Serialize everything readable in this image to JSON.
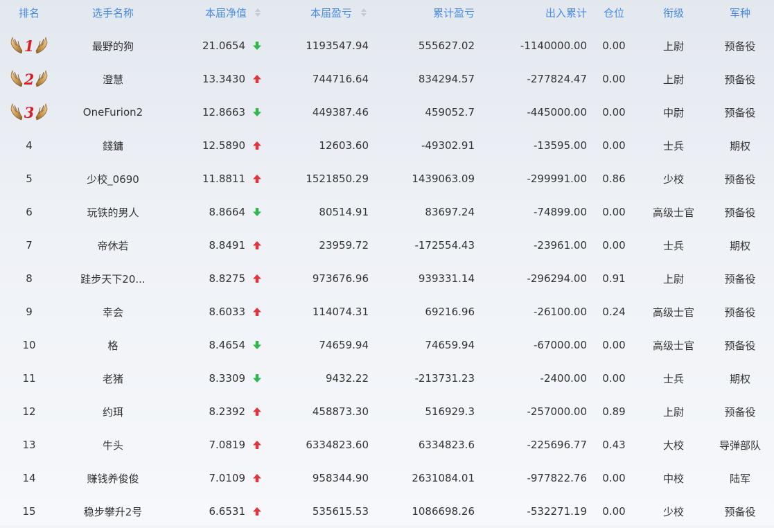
{
  "header": {
    "rank": "排名",
    "name": "选手名称",
    "nav": "本届净值",
    "pnl": "本届盈亏",
    "cumulative": "累计盈亏",
    "flow": "出入累计",
    "position": "仓位",
    "title": "衔级",
    "branch": "军种"
  },
  "colors": {
    "header_text": "#4a8be0",
    "up_arrow": "#e5333b",
    "down_arrow": "#2fb94b",
    "medal_number": "#d81f26"
  },
  "icons": {
    "up": "arrow-up-icon",
    "down": "arrow-down-icon",
    "medal": "winged-medal-icon",
    "sort": "sort-caret-icon"
  },
  "rows": [
    {
      "rank": "1",
      "medal": true,
      "name": "最野的狗",
      "nav": "21.0654",
      "dir": "down",
      "pnl": "1193547.94",
      "cumulative": "555627.02",
      "flow": "-1140000.00",
      "position": "0.00",
      "title": "上尉",
      "branch": "预备役"
    },
    {
      "rank": "2",
      "medal": true,
      "name": "澄慧",
      "nav": "13.3430",
      "dir": "up",
      "pnl": "744716.64",
      "cumulative": "834294.57",
      "flow": "-277824.47",
      "position": "0.00",
      "title": "上尉",
      "branch": "预备役"
    },
    {
      "rank": "3",
      "medal": true,
      "name": "OneFurion2",
      "nav": "12.8663",
      "dir": "down",
      "pnl": "449387.46",
      "cumulative": "459052.7",
      "flow": "-445000.00",
      "position": "0.00",
      "title": "中尉",
      "branch": "预备役"
    },
    {
      "rank": "4",
      "medal": false,
      "name": "錢鏞",
      "nav": "12.5890",
      "dir": "up",
      "pnl": "12603.60",
      "cumulative": "-49302.91",
      "flow": "-13595.00",
      "position": "0.00",
      "title": "士兵",
      "branch": "期权"
    },
    {
      "rank": "5",
      "medal": false,
      "name": "少校_0690",
      "nav": "11.8811",
      "dir": "up",
      "pnl": "1521850.29",
      "cumulative": "1439063.09",
      "flow": "-299991.00",
      "position": "0.86",
      "title": "少校",
      "branch": "预备役"
    },
    {
      "rank": "6",
      "medal": false,
      "name": "玩铁的男人",
      "nav": "8.8664",
      "dir": "down",
      "pnl": "80514.91",
      "cumulative": "83697.24",
      "flow": "-74899.00",
      "position": "0.00",
      "title": "高级士官",
      "branch": "预备役"
    },
    {
      "rank": "7",
      "medal": false,
      "name": "帝休若",
      "nav": "8.8491",
      "dir": "up",
      "pnl": "23959.72",
      "cumulative": "-172554.43",
      "flow": "-23961.00",
      "position": "0.00",
      "title": "士兵",
      "branch": "期权"
    },
    {
      "rank": "8",
      "medal": false,
      "name": "跬步天下20...",
      "nav": "8.8275",
      "dir": "up",
      "pnl": "973676.96",
      "cumulative": "939331.14",
      "flow": "-296294.00",
      "position": "0.91",
      "title": "上尉",
      "branch": "预备役"
    },
    {
      "rank": "9",
      "medal": false,
      "name": "幸会",
      "nav": "8.6033",
      "dir": "up",
      "pnl": "114074.31",
      "cumulative": "69216.96",
      "flow": "-26100.00",
      "position": "0.24",
      "title": "高级士官",
      "branch": "预备役"
    },
    {
      "rank": "10",
      "medal": false,
      "name": "格",
      "nav": "8.4654",
      "dir": "down",
      "pnl": "74659.94",
      "cumulative": "74659.94",
      "flow": "-67000.00",
      "position": "0.00",
      "title": "高级士官",
      "branch": "预备役"
    },
    {
      "rank": "11",
      "medal": false,
      "name": "老猪",
      "nav": "8.3309",
      "dir": "down",
      "pnl": "9432.22",
      "cumulative": "-213731.23",
      "flow": "-2400.00",
      "position": "0.00",
      "title": "士兵",
      "branch": "期权"
    },
    {
      "rank": "12",
      "medal": false,
      "name": "约珥",
      "nav": "8.2392",
      "dir": "up",
      "pnl": "458873.30",
      "cumulative": "516929.3",
      "flow": "-257000.00",
      "position": "0.89",
      "title": "上尉",
      "branch": "预备役"
    },
    {
      "rank": "13",
      "medal": false,
      "name": "牛头",
      "nav": "7.0819",
      "dir": "up",
      "pnl": "6334823.60",
      "cumulative": "6334823.6",
      "flow": "-225696.77",
      "position": "0.43",
      "title": "大校",
      "branch": "导弹部队"
    },
    {
      "rank": "14",
      "medal": false,
      "name": "赚钱养俊俊",
      "nav": "7.0109",
      "dir": "up",
      "pnl": "958344.90",
      "cumulative": "2631084.01",
      "flow": "-977822.76",
      "position": "0.00",
      "title": "中校",
      "branch": "陆军"
    },
    {
      "rank": "15",
      "medal": false,
      "name": "稳步攀升2号",
      "nav": "6.6531",
      "dir": "up",
      "pnl": "535615.53",
      "cumulative": "1086698.26",
      "flow": "-532271.19",
      "position": "0.00",
      "title": "少校",
      "branch": "预备役"
    }
  ]
}
